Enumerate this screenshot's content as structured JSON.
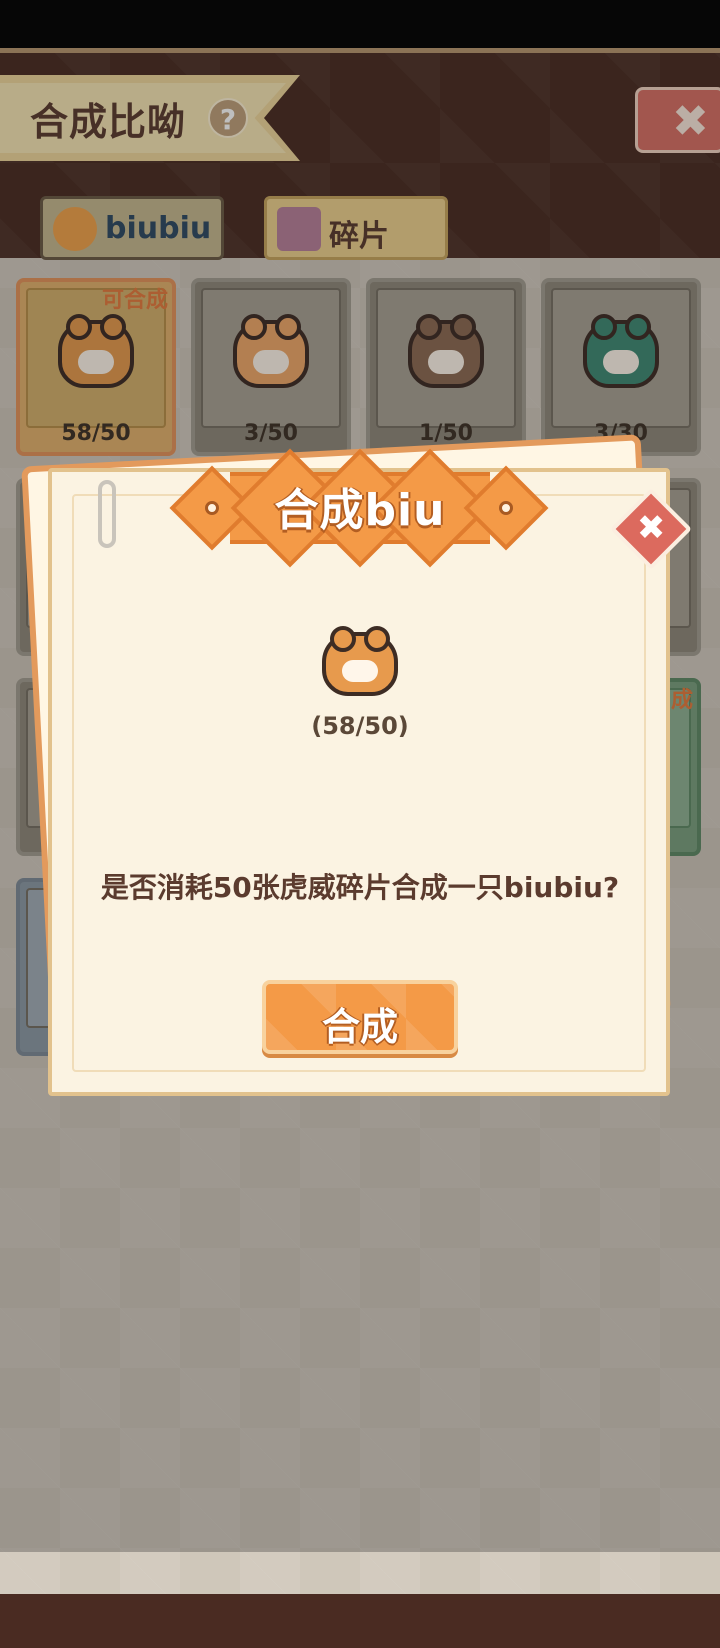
{
  "header": {
    "title": "合成比呦",
    "help_icon": "?",
    "close_icon": "✖",
    "tabs": [
      {
        "label": "biubiu",
        "icon": "cat-icon"
      },
      {
        "label": "碎片",
        "icon": "fragment-icon"
      }
    ]
  },
  "grid": {
    "cards": [
      {
        "count": "58/50",
        "tag": "可合成",
        "pet": "tiger"
      },
      {
        "count": "3/50",
        "pet": "fox"
      },
      {
        "count": "1/50",
        "pet": "samurai"
      },
      {
        "count": "3/30",
        "pet": "turtle"
      }
    ],
    "partial_tag": "成"
  },
  "dialog": {
    "title": "合成biu",
    "count": "(58/50)",
    "message": "是否消耗50张虎威碎片合成一只biubiu?",
    "button": "合成",
    "close_icon": "✖"
  }
}
